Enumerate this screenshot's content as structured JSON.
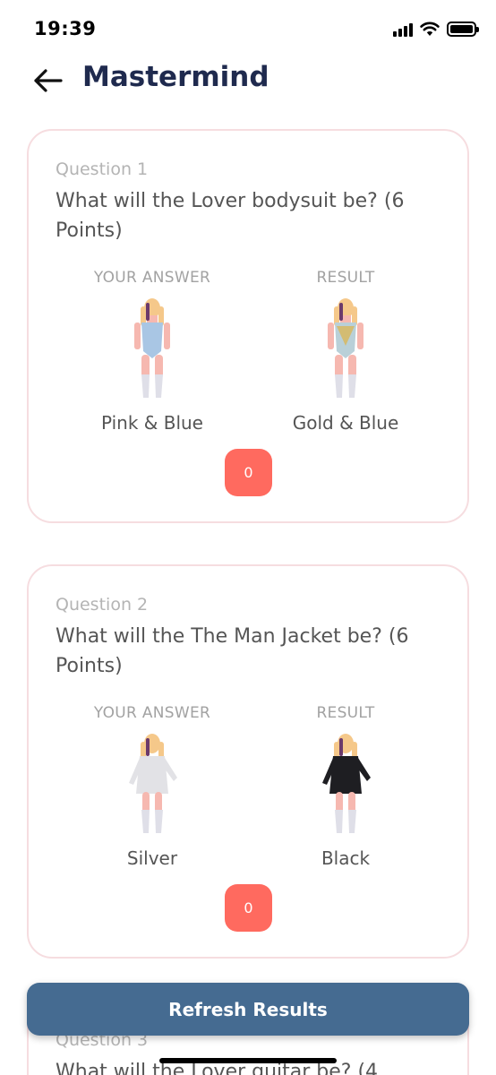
{
  "status_bar": {
    "time": "19:39"
  },
  "header": {
    "title": "Mastermind"
  },
  "questions": [
    {
      "number": "Question 1",
      "text": "What will the Lover bodysuit be? (6 Points)",
      "your_answer_label": "YOUR ANSWER",
      "result_label": "RESULT",
      "your_answer": "Pink & Blue",
      "result": "Gold & Blue",
      "score": "0"
    },
    {
      "number": "Question 2",
      "text": "What will the The Man Jacket be? (6 Points)",
      "your_answer_label": "YOUR ANSWER",
      "result_label": "RESULT",
      "your_answer": "Silver",
      "result": "Black",
      "score": "0"
    },
    {
      "number": "Question 3",
      "text": "What will the Lover guitar be? (4"
    }
  ],
  "refresh_button": {
    "label": "Refresh Results"
  },
  "colors": {
    "title": "#1f2a4e",
    "score_badge": "#ff6a5f",
    "refresh_button": "#456b91",
    "card_border": "#f6dde0"
  }
}
